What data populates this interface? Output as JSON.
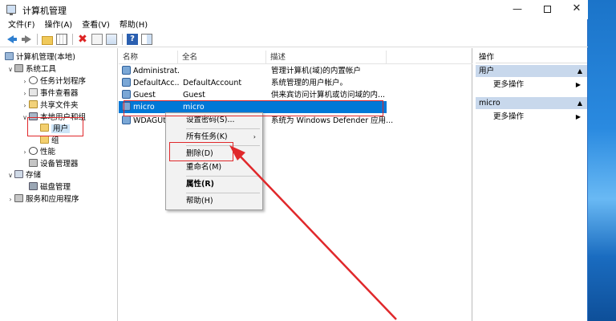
{
  "window": {
    "title": "计算机管理",
    "minimize": "—",
    "close": "✕"
  },
  "menubar": [
    {
      "label": "文件(F)"
    },
    {
      "label": "操作(A)"
    },
    {
      "label": "查看(V)"
    },
    {
      "label": "帮助(H)"
    }
  ],
  "toolbar": {
    "icons": [
      "back-icon",
      "forward-icon",
      "up-folder-icon",
      "show-hide-tree-icon",
      "delete-icon",
      "properties-icon",
      "export-list-icon",
      "help-icon",
      "action-pane-icon"
    ],
    "delete_glyph": "✖",
    "help_glyph": "?"
  },
  "tree": {
    "expanded_arrow": "∨",
    "collapsed_arrow": "›",
    "items": [
      {
        "label": "计算机管理(本地)",
        "icon": "computer-icon"
      },
      {
        "label": "系统工具",
        "icon": "tools-icon"
      },
      {
        "label": "任务计划程序",
        "icon": "clock-icon"
      },
      {
        "label": "事件查看器",
        "icon": "event-log-icon"
      },
      {
        "label": "共享文件夹",
        "icon": "shared-folder-icon"
      },
      {
        "label": "本地用户和组",
        "icon": "users-icon"
      },
      {
        "label": "用户",
        "icon": "folder-icon"
      },
      {
        "label": "组",
        "icon": "folder-icon"
      },
      {
        "label": "性能",
        "icon": "performance-icon"
      },
      {
        "label": "设备管理器",
        "icon": "device-icon"
      },
      {
        "label": "存储",
        "icon": "storage-icon"
      },
      {
        "label": "磁盘管理",
        "icon": "disk-icon"
      },
      {
        "label": "服务和应用程序",
        "icon": "services-icon"
      }
    ]
  },
  "list": {
    "columns": [
      "名称",
      "全名",
      "描述"
    ],
    "rows": [
      {
        "name": "Administrat...",
        "fullname": "",
        "desc": "管理计算机(域)的内置帐户"
      },
      {
        "name": "DefaultAcc...",
        "fullname": "DefaultAccount",
        "desc": "系统管理的用户帐户。"
      },
      {
        "name": "Guest",
        "fullname": "Guest",
        "desc": "供来宾访问计算机或访问域的内..."
      },
      {
        "name": "micro",
        "fullname": "micro",
        "desc": ""
      },
      {
        "name": "WDAGUti",
        "fullname": "",
        "desc": "系统为 Windows Defender 应用..."
      }
    ]
  },
  "context_menu": {
    "items": [
      {
        "label": "设置密码(S)...",
        "bold": false
      },
      {
        "label": "所有任务(K)",
        "bold": false,
        "submenu": true
      },
      {
        "label": "删除(D)",
        "bold": false
      },
      {
        "label": "重命名(M)",
        "bold": false
      },
      {
        "label": "属性(R)",
        "bold": true
      },
      {
        "label": "帮助(H)",
        "bold": false
      }
    ],
    "chevron": "›"
  },
  "actions": {
    "title": "操作",
    "sections": [
      {
        "label": "用户",
        "more": "更多操作"
      },
      {
        "label": "micro",
        "more": "更多操作"
      }
    ],
    "collapse_glyph": "▲",
    "more_glyph": "▶"
  },
  "colors": {
    "selection_blue": "#0078d7",
    "annotation_red": "#e0282b",
    "section_bg": "#c8d8ec"
  }
}
